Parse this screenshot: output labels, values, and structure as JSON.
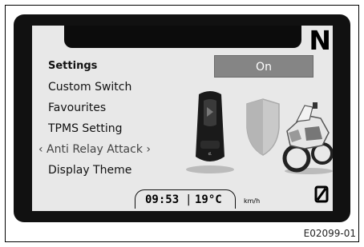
{
  "dashboard": {
    "gear": "N",
    "menu": {
      "title": "Settings",
      "items": [
        {
          "label": "Custom Switch"
        },
        {
          "label": "Favourites"
        },
        {
          "label": "TPMS Setting"
        },
        {
          "label": "‹ Anti Relay Attack ›",
          "selected": true
        },
        {
          "label": "Display Theme"
        }
      ]
    },
    "toggle": {
      "value": "On"
    },
    "status": {
      "time": "09:53",
      "separator": "|",
      "temperature": "19°C",
      "speed_unit": "km/h"
    },
    "icons": {
      "key_fob": "key-fob-icon",
      "shield": "shield-icon",
      "motorcycle": "motorcycle-icon",
      "zero_trip": "zero-slash-icon"
    }
  },
  "figure": {
    "code": "E02099-01"
  }
}
